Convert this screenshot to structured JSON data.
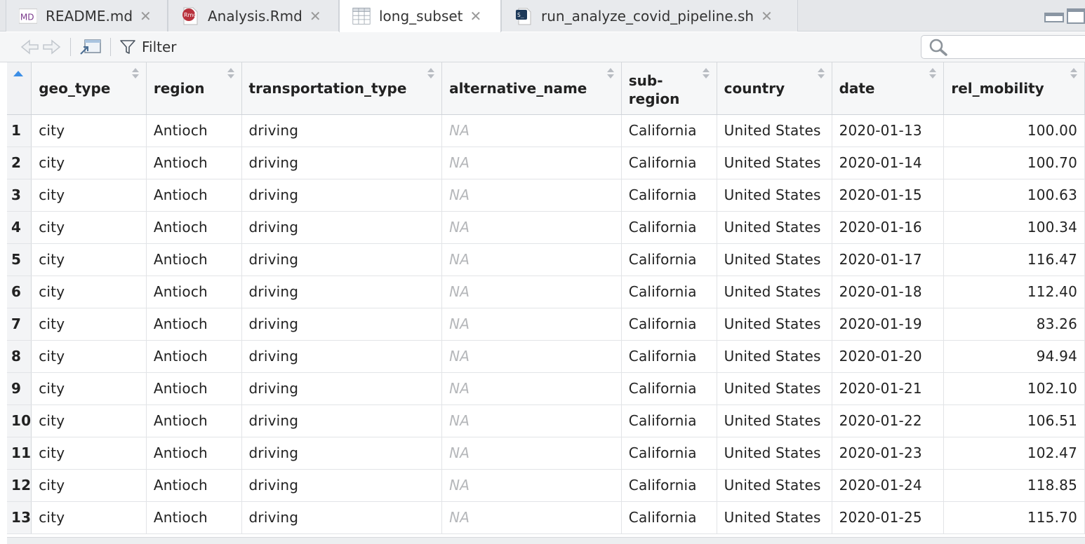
{
  "tabs": [
    {
      "label": "README.md",
      "icon": "markdown-file-icon",
      "active": false
    },
    {
      "label": "Analysis.Rmd",
      "icon": "rmarkdown-file-icon",
      "active": false
    },
    {
      "label": "long_subset",
      "icon": "data-table-icon",
      "active": true
    },
    {
      "label": "run_analyze_covid_pipeline.sh",
      "icon": "shell-script-icon",
      "active": false
    }
  ],
  "tab_icons": {
    "md": "MD",
    "rmd": "Rmd",
    "sh": "S_"
  },
  "toolbar": {
    "filter_label": "Filter",
    "search_placeholder": ""
  },
  "table": {
    "columns": [
      "geo_type",
      "region",
      "transportation_type",
      "alternative_name",
      "sub-\nregion",
      "country",
      "date",
      "rel_mobility"
    ],
    "rows": [
      {
        "idx": "1",
        "geo_type": "city",
        "region": "Antioch",
        "transportation_type": "driving",
        "alternative_name": "NA",
        "sub_region": "California",
        "country": "United States",
        "date": "2020-01-13",
        "rel_mobility": "100.00"
      },
      {
        "idx": "2",
        "geo_type": "city",
        "region": "Antioch",
        "transportation_type": "driving",
        "alternative_name": "NA",
        "sub_region": "California",
        "country": "United States",
        "date": "2020-01-14",
        "rel_mobility": "100.70"
      },
      {
        "idx": "3",
        "geo_type": "city",
        "region": "Antioch",
        "transportation_type": "driving",
        "alternative_name": "NA",
        "sub_region": "California",
        "country": "United States",
        "date": "2020-01-15",
        "rel_mobility": "100.63"
      },
      {
        "idx": "4",
        "geo_type": "city",
        "region": "Antioch",
        "transportation_type": "driving",
        "alternative_name": "NA",
        "sub_region": "California",
        "country": "United States",
        "date": "2020-01-16",
        "rel_mobility": "100.34"
      },
      {
        "idx": "5",
        "geo_type": "city",
        "region": "Antioch",
        "transportation_type": "driving",
        "alternative_name": "NA",
        "sub_region": "California",
        "country": "United States",
        "date": "2020-01-17",
        "rel_mobility": "116.47"
      },
      {
        "idx": "6",
        "geo_type": "city",
        "region": "Antioch",
        "transportation_type": "driving",
        "alternative_name": "NA",
        "sub_region": "California",
        "country": "United States",
        "date": "2020-01-18",
        "rel_mobility": "112.40"
      },
      {
        "idx": "7",
        "geo_type": "city",
        "region": "Antioch",
        "transportation_type": "driving",
        "alternative_name": "NA",
        "sub_region": "California",
        "country": "United States",
        "date": "2020-01-19",
        "rel_mobility": "83.26"
      },
      {
        "idx": "8",
        "geo_type": "city",
        "region": "Antioch",
        "transportation_type": "driving",
        "alternative_name": "NA",
        "sub_region": "California",
        "country": "United States",
        "date": "2020-01-20",
        "rel_mobility": "94.94"
      },
      {
        "idx": "9",
        "geo_type": "city",
        "region": "Antioch",
        "transportation_type": "driving",
        "alternative_name": "NA",
        "sub_region": "California",
        "country": "United States",
        "date": "2020-01-21",
        "rel_mobility": "102.10"
      },
      {
        "idx": "10",
        "geo_type": "city",
        "region": "Antioch",
        "transportation_type": "driving",
        "alternative_name": "NA",
        "sub_region": "California",
        "country": "United States",
        "date": "2020-01-22",
        "rel_mobility": "106.51"
      },
      {
        "idx": "11",
        "geo_type": "city",
        "region": "Antioch",
        "transportation_type": "driving",
        "alternative_name": "NA",
        "sub_region": "California",
        "country": "United States",
        "date": "2020-01-23",
        "rel_mobility": "102.47"
      },
      {
        "idx": "12",
        "geo_type": "city",
        "region": "Antioch",
        "transportation_type": "driving",
        "alternative_name": "NA",
        "sub_region": "California",
        "country": "United States",
        "date": "2020-01-24",
        "rel_mobility": "118.85"
      },
      {
        "idx": "13",
        "geo_type": "city",
        "region": "Antioch",
        "transportation_type": "driving",
        "alternative_name": "NA",
        "sub_region": "California",
        "country": "United States",
        "date": "2020-01-25",
        "rel_mobility": "115.70"
      }
    ]
  },
  "colors": {
    "accent": "#3b8ee6",
    "na_text": "#b5b7ba",
    "rmd_icon": "#b8323d",
    "md_icon": "#7a3a8c",
    "sh_icon": "#1f3a5a"
  }
}
